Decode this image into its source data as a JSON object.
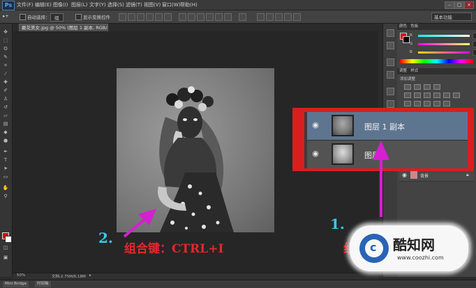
{
  "app": {
    "logo": "Ps",
    "menus": [
      "文件(F)",
      "编辑(E)",
      "图像(I)",
      "图层(L)",
      "文字(Y)",
      "选择(S)",
      "滤镜(T)",
      "视图(V)",
      "窗口(W)",
      "帮助(H)"
    ]
  },
  "options_bar": {
    "auto_select_label": "自动选择：",
    "auto_select_value": "组",
    "show_transform_label": "显示变换控件",
    "workspace": "基本功能"
  },
  "document": {
    "tab_title": "戴花美女.jpg @ 50% (图层 1 副本, RGB/8) *",
    "zoom": "50%",
    "doc_info": "文档:2.75M/6.18M"
  },
  "bottom_tabs": [
    "Mini Bridge",
    "时间轴"
  ],
  "color_panel": {
    "tab_color": "颜色",
    "tab_swatches": "色板",
    "r": "243",
    "g": "253",
    "b": "106"
  },
  "adjustments_panel": {
    "tab_adjust": "调整",
    "tab_styles": "样式",
    "add_label": "添加调整"
  },
  "layers": [
    {
      "name": "图层 1 副本",
      "selected": true
    },
    {
      "name": "图层 1",
      "selected": false
    }
  ],
  "layers_mini": {
    "background_label": "背景"
  },
  "annotations": {
    "step1": "1.",
    "step2": "2.",
    "combo_key": "组合键：CTRL+I",
    "combo_key_partial": "组"
  },
  "watermark": {
    "title": "酷知网",
    "url": "www.coozhi.com"
  },
  "colors": {
    "accent_red": "#d81f1f",
    "arrow_magenta": "#d61fd0",
    "step_cyan": "#39c8ee",
    "fg_color": "#e00000"
  }
}
